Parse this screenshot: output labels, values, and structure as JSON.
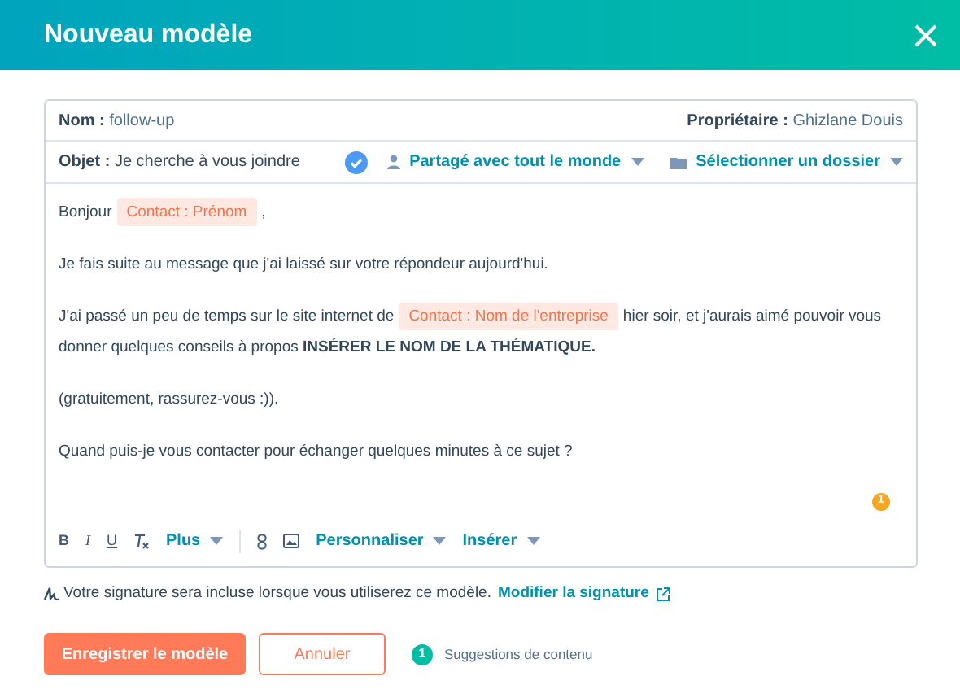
{
  "dialog": {
    "title": "Nouveau modèle"
  },
  "template": {
    "name_label": "Nom :",
    "name_value": "follow-up",
    "owner_label": "Propriétaire :",
    "owner_value": "Ghizlane Douis",
    "subject_label": "Objet :",
    "subject_value": "Je cherche à vous joindre",
    "subject_valid": true,
    "sharing": "Partagé avec tout le monde",
    "folder": "Sélectionner un dossier"
  },
  "body": [
    [
      [
        {
          "kind": "text",
          "text": "Bonjour"
        },
        {
          "kind": "token",
          "text": "Contact : Prénom"
        },
        {
          "kind": "text",
          "text": ","
        }
      ]
    ],
    [
      [
        {
          "kind": "text",
          "text": "Je fais suite au message que j'ai laissé sur votre répondeur aujourd'hui."
        }
      ]
    ],
    [
      [
        {
          "kind": "text",
          "text": "J'ai passé un peu de temps sur le site internet de"
        },
        {
          "kind": "token",
          "text": "Contact : Nom de l'entreprise"
        },
        {
          "kind": "text",
          "text": "hier soir, et j'aurais aimé pouvoir vous"
        }
      ],
      [
        {
          "kind": "text",
          "text": "donner quelques conseils à propos **INSÉRER LE NOM DE LA THÉMATIQUE.**"
        }
      ]
    ],
    [
      [
        {
          "kind": "text",
          "text": "(gratuitement, rassurez-vous :))."
        }
      ]
    ],
    [
      [
        {
          "kind": "text",
          "text": "Quand puis-je vous contacter pour échanger quelques minutes à ce sujet ?"
        }
      ]
    ]
  ],
  "warning_badge": "1",
  "toolbar": [
    {
      "kind": "format",
      "label": "B"
    },
    {
      "kind": "format",
      "label": "I"
    },
    {
      "kind": "format",
      "label": "U"
    },
    {
      "kind": "clear"
    },
    {
      "kind": "menu",
      "label": "Plus"
    },
    {
      "kind": "divider"
    },
    {
      "kind": "link"
    },
    {
      "kind": "image"
    },
    {
      "kind": "menu",
      "label": "Personnaliser"
    },
    {
      "kind": "menu",
      "label": "Insérer"
    }
  ],
  "signature": {
    "text": "Votre signature sera incluse lorsque vous utiliserez ce modèle.",
    "link": "Modifier la signature"
  },
  "footer": {
    "save": "Enregistrer le modèle",
    "cancel": "Annuler",
    "suggestions_count": "1",
    "suggestions": "Suggestions de contenu"
  }
}
